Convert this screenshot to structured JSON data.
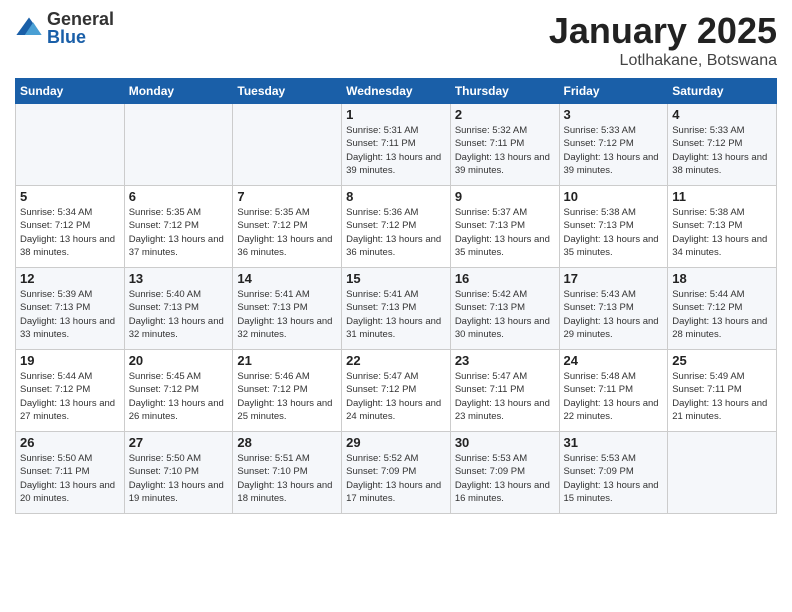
{
  "logo": {
    "general": "General",
    "blue": "Blue"
  },
  "title": "January 2025",
  "location": "Lotlhakane, Botswana",
  "weekdays": [
    "Sunday",
    "Monday",
    "Tuesday",
    "Wednesday",
    "Thursday",
    "Friday",
    "Saturday"
  ],
  "weeks": [
    [
      {
        "day": "",
        "info": ""
      },
      {
        "day": "",
        "info": ""
      },
      {
        "day": "",
        "info": ""
      },
      {
        "day": "1",
        "sunrise": "5:31 AM",
        "sunset": "7:11 PM",
        "daylight": "13 hours and 39 minutes."
      },
      {
        "day": "2",
        "sunrise": "5:32 AM",
        "sunset": "7:11 PM",
        "daylight": "13 hours and 39 minutes."
      },
      {
        "day": "3",
        "sunrise": "5:33 AM",
        "sunset": "7:12 PM",
        "daylight": "13 hours and 39 minutes."
      },
      {
        "day": "4",
        "sunrise": "5:33 AM",
        "sunset": "7:12 PM",
        "daylight": "13 hours and 38 minutes."
      }
    ],
    [
      {
        "day": "5",
        "sunrise": "5:34 AM",
        "sunset": "7:12 PM",
        "daylight": "13 hours and 38 minutes."
      },
      {
        "day": "6",
        "sunrise": "5:35 AM",
        "sunset": "7:12 PM",
        "daylight": "13 hours and 37 minutes."
      },
      {
        "day": "7",
        "sunrise": "5:35 AM",
        "sunset": "7:12 PM",
        "daylight": "13 hours and 36 minutes."
      },
      {
        "day": "8",
        "sunrise": "5:36 AM",
        "sunset": "7:12 PM",
        "daylight": "13 hours and 36 minutes."
      },
      {
        "day": "9",
        "sunrise": "5:37 AM",
        "sunset": "7:13 PM",
        "daylight": "13 hours and 35 minutes."
      },
      {
        "day": "10",
        "sunrise": "5:38 AM",
        "sunset": "7:13 PM",
        "daylight": "13 hours and 35 minutes."
      },
      {
        "day": "11",
        "sunrise": "5:38 AM",
        "sunset": "7:13 PM",
        "daylight": "13 hours and 34 minutes."
      }
    ],
    [
      {
        "day": "12",
        "sunrise": "5:39 AM",
        "sunset": "7:13 PM",
        "daylight": "13 hours and 33 minutes."
      },
      {
        "day": "13",
        "sunrise": "5:40 AM",
        "sunset": "7:13 PM",
        "daylight": "13 hours and 32 minutes."
      },
      {
        "day": "14",
        "sunrise": "5:41 AM",
        "sunset": "7:13 PM",
        "daylight": "13 hours and 32 minutes."
      },
      {
        "day": "15",
        "sunrise": "5:41 AM",
        "sunset": "7:13 PM",
        "daylight": "13 hours and 31 minutes."
      },
      {
        "day": "16",
        "sunrise": "5:42 AM",
        "sunset": "7:13 PM",
        "daylight": "13 hours and 30 minutes."
      },
      {
        "day": "17",
        "sunrise": "5:43 AM",
        "sunset": "7:13 PM",
        "daylight": "13 hours and 29 minutes."
      },
      {
        "day": "18",
        "sunrise": "5:44 AM",
        "sunset": "7:12 PM",
        "daylight": "13 hours and 28 minutes."
      }
    ],
    [
      {
        "day": "19",
        "sunrise": "5:44 AM",
        "sunset": "7:12 PM",
        "daylight": "13 hours and 27 minutes."
      },
      {
        "day": "20",
        "sunrise": "5:45 AM",
        "sunset": "7:12 PM",
        "daylight": "13 hours and 26 minutes."
      },
      {
        "day": "21",
        "sunrise": "5:46 AM",
        "sunset": "7:12 PM",
        "daylight": "13 hours and 25 minutes."
      },
      {
        "day": "22",
        "sunrise": "5:47 AM",
        "sunset": "7:12 PM",
        "daylight": "13 hours and 24 minutes."
      },
      {
        "day": "23",
        "sunrise": "5:47 AM",
        "sunset": "7:11 PM",
        "daylight": "13 hours and 23 minutes."
      },
      {
        "day": "24",
        "sunrise": "5:48 AM",
        "sunset": "7:11 PM",
        "daylight": "13 hours and 22 minutes."
      },
      {
        "day": "25",
        "sunrise": "5:49 AM",
        "sunset": "7:11 PM",
        "daylight": "13 hours and 21 minutes."
      }
    ],
    [
      {
        "day": "26",
        "sunrise": "5:50 AM",
        "sunset": "7:11 PM",
        "daylight": "13 hours and 20 minutes."
      },
      {
        "day": "27",
        "sunrise": "5:50 AM",
        "sunset": "7:10 PM",
        "daylight": "13 hours and 19 minutes."
      },
      {
        "day": "28",
        "sunrise": "5:51 AM",
        "sunset": "7:10 PM",
        "daylight": "13 hours and 18 minutes."
      },
      {
        "day": "29",
        "sunrise": "5:52 AM",
        "sunset": "7:09 PM",
        "daylight": "13 hours and 17 minutes."
      },
      {
        "day": "30",
        "sunrise": "5:53 AM",
        "sunset": "7:09 PM",
        "daylight": "13 hours and 16 minutes."
      },
      {
        "day": "31",
        "sunrise": "5:53 AM",
        "sunset": "7:09 PM",
        "daylight": "13 hours and 15 minutes."
      },
      {
        "day": "",
        "info": ""
      }
    ]
  ]
}
